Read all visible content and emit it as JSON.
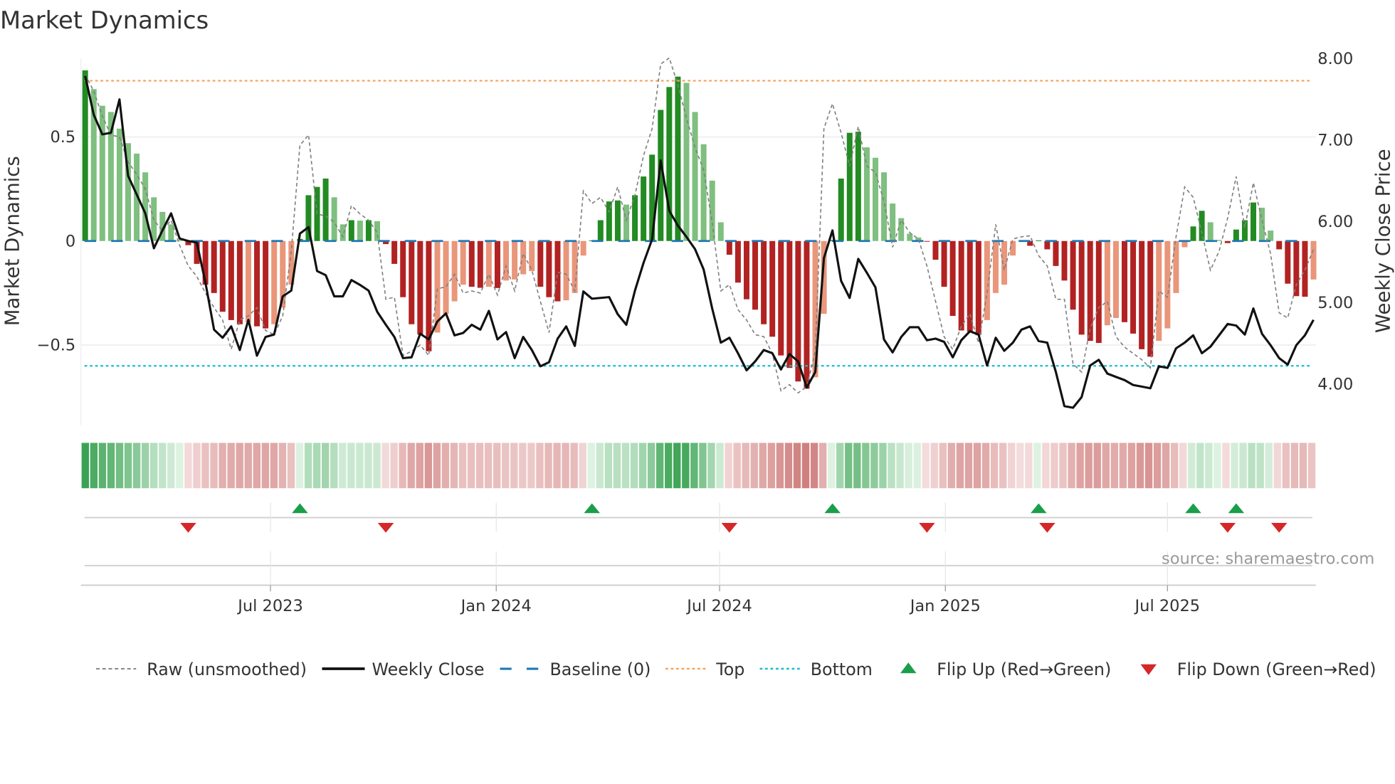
{
  "chart_data": {
    "type": "bar",
    "title": "Market Dynamics",
    "ylabel": "Market Dynamics",
    "y2label": "Weekly Close Price",
    "source": "source: sharemaestro.com",
    "start_date": "2023-01-31",
    "interval_days": 7,
    "ylim": [
      -0.89,
      0.87
    ],
    "y2lim": [
      3.5,
      8.0
    ],
    "yticks": [
      {
        "v": 0.5,
        "label": "0.5"
      },
      {
        "v": 0,
        "label": "0"
      },
      {
        "v": -0.5,
        "label": "−0.5"
      }
    ],
    "y2ticks": [
      {
        "v": 8,
        "label": "8.00"
      },
      {
        "v": 7,
        "label": "7.00"
      },
      {
        "v": 6,
        "label": "6.00"
      },
      {
        "v": 5,
        "label": "5.00"
      },
      {
        "v": 4,
        "label": "4.00"
      }
    ],
    "xticks": [
      {
        "date": "2023-07-01",
        "label": "Jul 2023"
      },
      {
        "date": "2024-01-01",
        "label": "Jan 2024"
      },
      {
        "date": "2024-07-01",
        "label": "Jul 2024"
      },
      {
        "date": "2025-01-01",
        "label": "Jan 2025"
      },
      {
        "date": "2025-07-01",
        "label": "Jul 2025"
      }
    ],
    "top_level": 0.77,
    "bottom_level": -0.6,
    "baseline": 0,
    "colors": {
      "green_dark": "#228b22",
      "green_light": "#7fbf7f",
      "red_dark": "#b22222",
      "red_light": "#e9967a",
      "raw": "#808080",
      "close": "#111111",
      "baseline": "#1f77b4",
      "top": "#f4a460",
      "bottom": "#17becf",
      "flip_up": "#1a9e4a",
      "flip_down": "#d62728"
    },
    "legend": {
      "placement": "bottom",
      "raw": "Raw (unsmoothed)",
      "close": "Weekly Close",
      "baseline": "Baseline (0)",
      "top": "Top",
      "bottom": "Bottom",
      "flip_up": "Flip Up (Red→Green)",
      "flip_down": "Flip Down (Green→Red)"
    },
    "market_dynamics": [
      0.82,
      0.73,
      0.65,
      0.62,
      0.54,
      0.47,
      0.42,
      0.33,
      0.21,
      0.14,
      0.08,
      0.005,
      -0.02,
      -0.11,
      -0.21,
      -0.25,
      -0.34,
      -0.38,
      -0.4,
      -0.39,
      -0.41,
      -0.42,
      -0.4,
      -0.32,
      -0.21,
      0.01,
      0.22,
      0.26,
      0.3,
      0.21,
      0.08,
      0.1,
      0.098,
      0.1,
      0.095,
      -0.015,
      -0.11,
      -0.27,
      -0.4,
      -0.45,
      -0.53,
      -0.44,
      -0.35,
      -0.29,
      -0.21,
      -0.22,
      -0.225,
      -0.22,
      -0.226,
      -0.19,
      -0.185,
      -0.16,
      -0.145,
      -0.22,
      -0.27,
      -0.29,
      -0.285,
      -0.25,
      -0.07,
      0.003,
      0.1,
      0.19,
      0.195,
      0.175,
      0.22,
      0.31,
      0.415,
      0.63,
      0.74,
      0.79,
      0.76,
      0.62,
      0.465,
      0.29,
      0.09,
      -0.066,
      -0.2,
      -0.28,
      -0.33,
      -0.4,
      -0.46,
      -0.55,
      -0.61,
      -0.675,
      -0.71,
      -0.655,
      -0.35,
      0.005,
      0.3,
      0.52,
      0.525,
      0.45,
      0.4,
      0.33,
      0.18,
      0.11,
      0.035,
      0.017,
      -0.003,
      -0.09,
      -0.22,
      -0.36,
      -0.43,
      -0.436,
      -0.45,
      -0.38,
      -0.25,
      -0.21,
      -0.07,
      -0.003,
      -0.023,
      0.003,
      -0.04,
      -0.12,
      -0.19,
      -0.33,
      -0.45,
      -0.48,
      -0.49,
      -0.405,
      -0.37,
      -0.39,
      -0.445,
      -0.52,
      -0.556,
      -0.48,
      -0.42,
      -0.25,
      -0.03,
      0.07,
      0.145,
      0.09,
      0.005,
      -0.01,
      0.055,
      0.1,
      0.185,
      0.16,
      0.05,
      -0.04,
      -0.205,
      -0.265,
      -0.268,
      -0.185
    ],
    "raw": [
      0.8,
      0.72,
      0.6,
      0.51,
      0.5,
      0.38,
      0.32,
      0.25,
      0.1,
      0.05,
      0.1,
      -0.02,
      -0.12,
      -0.17,
      -0.25,
      -0.32,
      -0.38,
      -0.52,
      -0.38,
      -0.36,
      -0.32,
      -0.43,
      -0.45,
      -0.36,
      -0.05,
      0.46,
      0.51,
      0.13,
      0.12,
      0.09,
      0.02,
      0.17,
      0.13,
      0.1,
      0.04,
      -0.28,
      -0.27,
      -0.55,
      -0.53,
      -0.5,
      -0.55,
      -0.23,
      -0.22,
      -0.16,
      -0.25,
      -0.24,
      -0.25,
      -0.16,
      -0.26,
      -0.12,
      -0.24,
      -0.06,
      -0.14,
      -0.29,
      -0.44,
      -0.15,
      -0.16,
      -0.24,
      0.24,
      0.18,
      0.21,
      0.14,
      0.26,
      0.1,
      0.22,
      0.41,
      0.54,
      0.85,
      0.88,
      0.75,
      0.59,
      0.45,
      0.34,
      0.09,
      -0.24,
      -0.21,
      -0.33,
      -0.38,
      -0.45,
      -0.46,
      -0.54,
      -0.72,
      -0.69,
      -0.73,
      -0.7,
      -0.53,
      0.54,
      0.66,
      0.52,
      0.36,
      0.55,
      0.36,
      0.33,
      0.19,
      -0.03,
      0.1,
      0.04,
      0.01,
      -0.12,
      -0.29,
      -0.46,
      -0.52,
      -0.41,
      -0.35,
      -0.49,
      -0.25,
      0.08,
      -0.14,
      0.01,
      0.02,
      0.025,
      -0.07,
      -0.12,
      -0.28,
      -0.28,
      -0.59,
      -0.63,
      -0.42,
      -0.32,
      -0.29,
      -0.46,
      -0.51,
      -0.54,
      -0.57,
      -0.61,
      -0.24,
      -0.27,
      0.02,
      0.26,
      0.21,
      0.04,
      -0.14,
      -0.05,
      0.11,
      0.31,
      0.065,
      0.28,
      0.1,
      -0.06,
      -0.345,
      -0.37,
      -0.21,
      -0.14,
      -0.04
    ],
    "weekly_close": [
      7.79,
      7.31,
      7.07,
      7.09,
      7.5,
      6.56,
      6.33,
      6.1,
      5.67,
      5.89,
      6.1,
      5.79,
      5.76,
      5.74,
      5.25,
      4.67,
      4.57,
      4.71,
      4.42,
      4.79,
      4.35,
      4.58,
      4.61,
      5.08,
      5.15,
      5.85,
      5.93,
      5.39,
      5.34,
      5.08,
      5.08,
      5.28,
      5.22,
      5.15,
      4.89,
      4.73,
      4.58,
      4.32,
      4.33,
      4.62,
      4.55,
      4.77,
      4.87,
      4.6,
      4.63,
      4.73,
      4.67,
      4.9,
      4.55,
      4.64,
      4.32,
      4.58,
      4.42,
      4.22,
      4.27,
      4.56,
      4.71,
      4.47,
      5.14,
      5.05,
      5.06,
      5.07,
      4.86,
      4.73,
      5.15,
      5.49,
      5.78,
      6.75,
      6.13,
      5.95,
      5.81,
      5.66,
      5.41,
      4.93,
      4.51,
      4.57,
      4.38,
      4.17,
      4.28,
      4.42,
      4.38,
      4.18,
      4.37,
      4.28,
      3.96,
      4.15,
      5.55,
      5.89,
      5.27,
      5.06,
      5.54,
      5.37,
      5.19,
      4.55,
      4.39,
      4.58,
      4.7,
      4.7,
      4.54,
      4.56,
      4.52,
      4.33,
      4.54,
      4.65,
      4.61,
      4.23,
      4.57,
      4.41,
      4.51,
      4.67,
      4.71,
      4.53,
      4.51,
      4.15,
      3.73,
      3.71,
      3.84,
      4.23,
      4.3,
      4.13,
      4.09,
      4.05,
      3.99,
      3.97,
      3.95,
      4.22,
      4.2,
      4.44,
      4.51,
      4.6,
      4.38,
      4.46,
      4.6,
      4.74,
      4.72,
      4.61,
      4.93,
      4.62,
      4.48,
      4.32,
      4.24,
      4.48,
      4.6,
      4.79
    ],
    "flip_up_weeks": [
      25,
      59,
      87,
      111,
      129,
      134
    ],
    "flip_down_weeks": [
      12,
      35,
      75,
      98,
      112,
      133,
      139
    ]
  }
}
